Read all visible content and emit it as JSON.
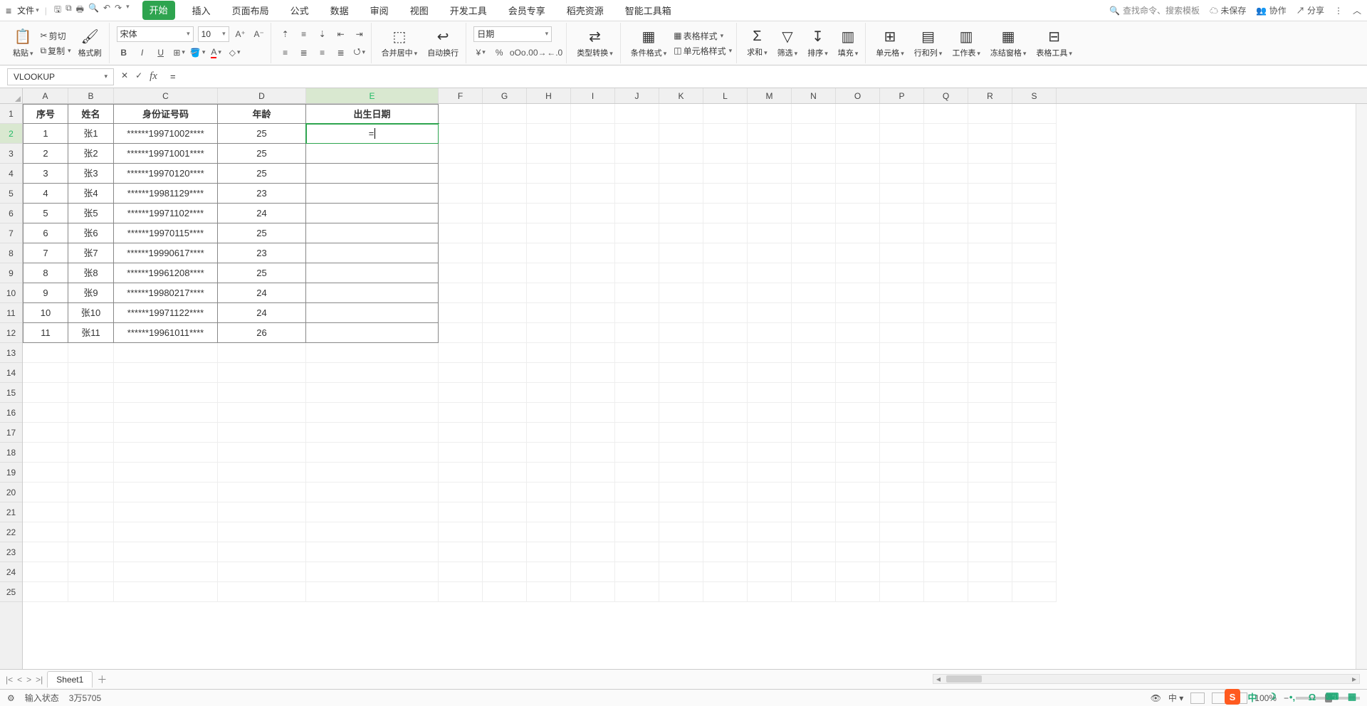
{
  "menu": {
    "file": "文件",
    "tabs": [
      "开始",
      "插入",
      "页面布局",
      "公式",
      "数据",
      "审阅",
      "视图",
      "开发工具",
      "会员专享",
      "稻壳资源",
      "智能工具箱"
    ],
    "active_tab": "开始",
    "search_placeholder": "查找命令、搜索模板",
    "unsaved": "未保存",
    "collab": "协作",
    "share": "分享"
  },
  "ribbon": {
    "paste": "粘贴",
    "cut": "剪切",
    "copy": "复制",
    "format_painter": "格式刷",
    "font_name": "宋体",
    "font_size": "10",
    "merge": "合并居中",
    "wrap": "自动换行",
    "number_format": "日期",
    "type_convert": "类型转换",
    "cond_fmt": "条件格式",
    "table_style": "表格样式",
    "cell_style": "单元格样式",
    "sum": "求和",
    "filter": "筛选",
    "sort": "排序",
    "fill": "填充",
    "cells": "单元格",
    "rows_cols": "行和列",
    "worksheet": "工作表",
    "freeze": "冻结窗格",
    "table_tools": "表格工具"
  },
  "name_box": "VLOOKUP",
  "formula_bar": "=",
  "columns": {
    "labels": [
      "A",
      "B",
      "C",
      "D",
      "E",
      "F",
      "G",
      "H",
      "I",
      "J",
      "K",
      "L",
      "M",
      "N",
      "O",
      "P",
      "Q",
      "R",
      "S"
    ],
    "widths": [
      64,
      64,
      146,
      124,
      186,
      62,
      62,
      62,
      62,
      62,
      62,
      62,
      62,
      62,
      62,
      62,
      62,
      62,
      62
    ],
    "active_index": 4
  },
  "row_count": 25,
  "active_row_index": 1,
  "headers": [
    "序号",
    "姓名",
    "身份证号码",
    "年龄",
    "出生日期"
  ],
  "data_rows": [
    {
      "no": "1",
      "name": "张1",
      "id": "******19971002****",
      "age": "25",
      "dob": "="
    },
    {
      "no": "2",
      "name": "张2",
      "id": "******19971001****",
      "age": "25",
      "dob": ""
    },
    {
      "no": "3",
      "name": "张3",
      "id": "******19970120****",
      "age": "25",
      "dob": ""
    },
    {
      "no": "4",
      "name": "张4",
      "id": "******19981129****",
      "age": "23",
      "dob": ""
    },
    {
      "no": "5",
      "name": "张5",
      "id": "******19971102****",
      "age": "24",
      "dob": ""
    },
    {
      "no": "6",
      "name": "张6",
      "id": "******19970115****",
      "age": "25",
      "dob": ""
    },
    {
      "no": "7",
      "name": "张7",
      "id": "******19990617****",
      "age": "23",
      "dob": ""
    },
    {
      "no": "8",
      "name": "张8",
      "id": "******19961208****",
      "age": "25",
      "dob": ""
    },
    {
      "no": "9",
      "name": "张9",
      "id": "******19980217****",
      "age": "24",
      "dob": ""
    },
    {
      "no": "10",
      "name": "张10",
      "id": "******19971122****",
      "age": "24",
      "dob": ""
    },
    {
      "no": "11",
      "name": "张11",
      "id": "******19961011****",
      "age": "26",
      "dob": ""
    }
  ],
  "active_cell_value": "=",
  "sheet": {
    "name": "Sheet1"
  },
  "status": {
    "mode": "输入状态",
    "info": "3万5705",
    "zoom": "100%"
  }
}
